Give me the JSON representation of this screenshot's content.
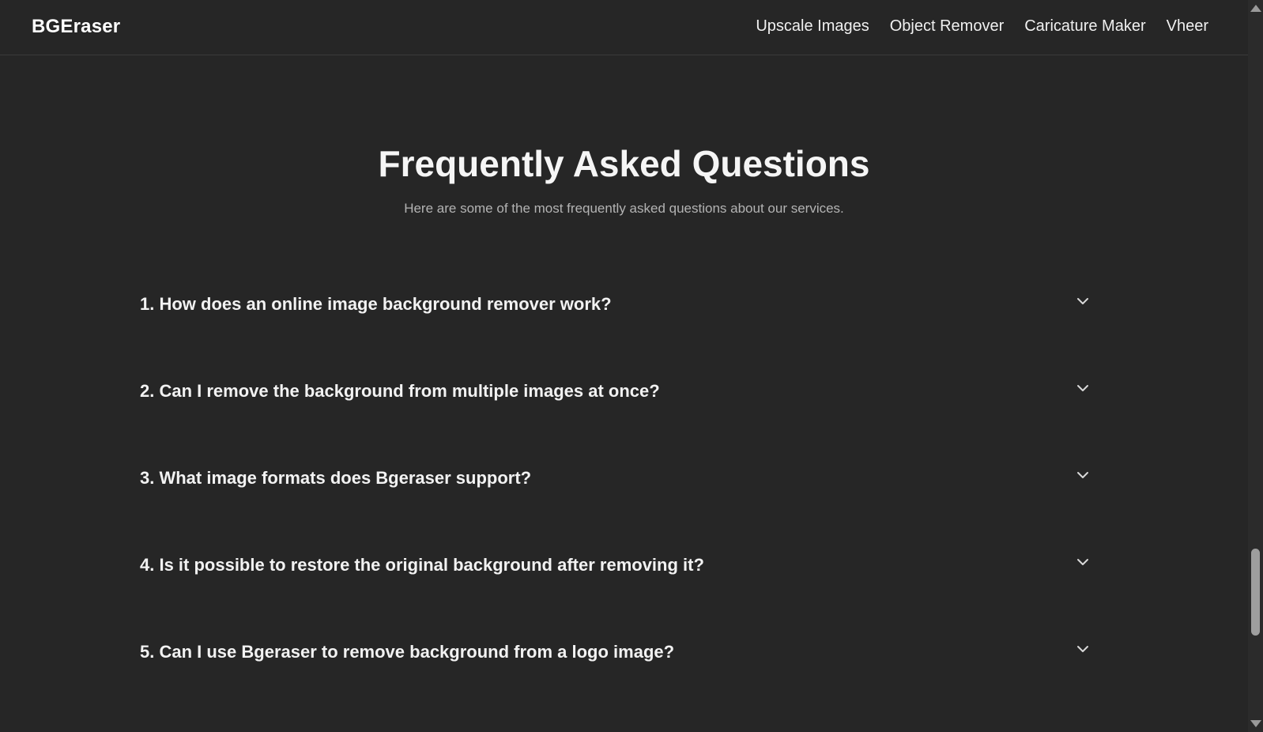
{
  "header": {
    "brand": "BGEraser",
    "nav_items": [
      {
        "label": "Upscale Images"
      },
      {
        "label": "Object Remover"
      },
      {
        "label": "Caricature Maker"
      },
      {
        "label": "Vheer"
      }
    ]
  },
  "faq": {
    "title": "Frequently Asked Questions",
    "subtitle": "Here are some of the most frequently asked questions about our services.",
    "items": [
      {
        "question": "1. How does an online image background remover work?",
        "icon": "chevron-down-icon"
      },
      {
        "question": "2. Can I remove the background from multiple images at once?",
        "icon": "chevron-down-icon"
      },
      {
        "question": "3. What image formats does Bgeraser support?",
        "icon": "chevron-down-icon"
      },
      {
        "question": "4. Is it possible to restore the original background after removing it?",
        "icon": "chevron-down-icon"
      },
      {
        "question": "5. Can I use Bgeraser to remove background from a logo image?",
        "icon": "chevron-down-icon"
      }
    ]
  },
  "colors": {
    "background": "#262626",
    "text": "#f2f2f2",
    "muted_text": "#b3b3b3",
    "scroll_thumb": "#9e9e9e"
  }
}
